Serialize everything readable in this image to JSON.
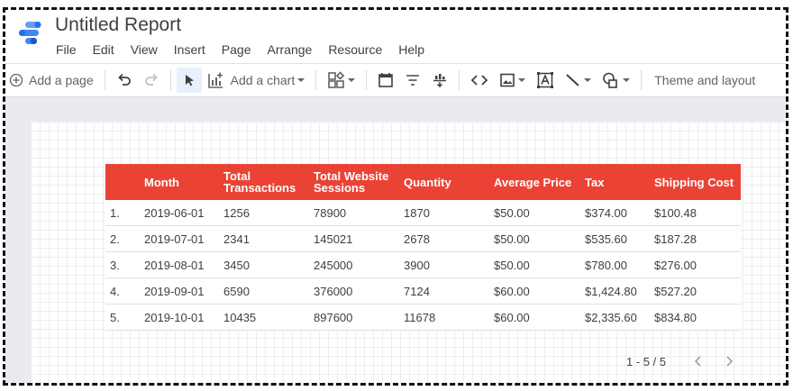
{
  "app": {
    "title": "Untitled Report",
    "menu": [
      "File",
      "Edit",
      "View",
      "Insert",
      "Page",
      "Arrange",
      "Resource",
      "Help"
    ]
  },
  "toolbar": {
    "add_page_label": "Add a page",
    "add_chart_label": "Add a chart",
    "theme_label": "Theme and layout"
  },
  "table": {
    "header_color": "#ea4335",
    "headers": [
      "Month",
      "Total Transactions",
      "Total Website Sessions",
      "Quantity",
      "Average Price",
      "Tax",
      "Shipping Cost"
    ],
    "rows": [
      {
        "index": "1.",
        "month": "2019-06-01",
        "transactions": "1256",
        "sessions": "78900",
        "quantity": "1870",
        "avg_price": "$50.00",
        "tax": "$374.00",
        "shipping": "$100.48"
      },
      {
        "index": "2.",
        "month": "2019-07-01",
        "transactions": "2341",
        "sessions": "145021",
        "quantity": "2678",
        "avg_price": "$50.00",
        "tax": "$535.60",
        "shipping": "$187.28"
      },
      {
        "index": "3.",
        "month": "2019-08-01",
        "transactions": "3450",
        "sessions": "245000",
        "quantity": "3900",
        "avg_price": "$50.00",
        "tax": "$780.00",
        "shipping": "$276.00"
      },
      {
        "index": "4.",
        "month": "2019-09-01",
        "transactions": "6590",
        "sessions": "376000",
        "quantity": "7124",
        "avg_price": "$60.00",
        "tax": "$1,424.80",
        "shipping": "$527.20"
      },
      {
        "index": "5.",
        "month": "2019-10-01",
        "transactions": "10435",
        "sessions": "897600",
        "quantity": "11678",
        "avg_price": "$60.00",
        "tax": "$2,335.60",
        "shipping": "$834.80"
      }
    ]
  },
  "pagination": {
    "text": "1 - 5 / 5"
  }
}
